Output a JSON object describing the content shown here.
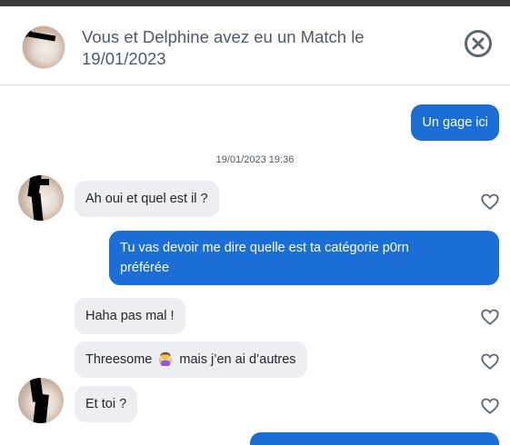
{
  "header": {
    "title": "Vous et Delphine avez eu un Match le 19/01/2023",
    "close_icon": "close-circle-icon"
  },
  "messages": [
    {
      "id": "m1",
      "direction": "outgoing",
      "text": "Un gage ici"
    },
    {
      "id": "m2",
      "direction": "incoming",
      "text": "Ah oui et quel est il ?"
    },
    {
      "id": "m3",
      "direction": "outgoing",
      "text_line1": "Tu vas devoir me dire quelle est ta catégorie p0rn",
      "text_line2": "préférée"
    },
    {
      "id": "m4",
      "direction": "incoming",
      "text": "Haha pas mal !"
    },
    {
      "id": "m5",
      "direction": "incoming",
      "text_before": "Threesome",
      "emoji": "person-gesturing-emoji",
      "text_after": "mais j’en ai d’autres"
    },
    {
      "id": "m6",
      "direction": "incoming",
      "text": "Et toi ?"
    }
  ],
  "timestamp": "19/01/2023 19:36",
  "colors": {
    "outgoing_bubble": "#1a6ed6",
    "incoming_bubble": "#eceef1",
    "header_text": "#505965"
  }
}
